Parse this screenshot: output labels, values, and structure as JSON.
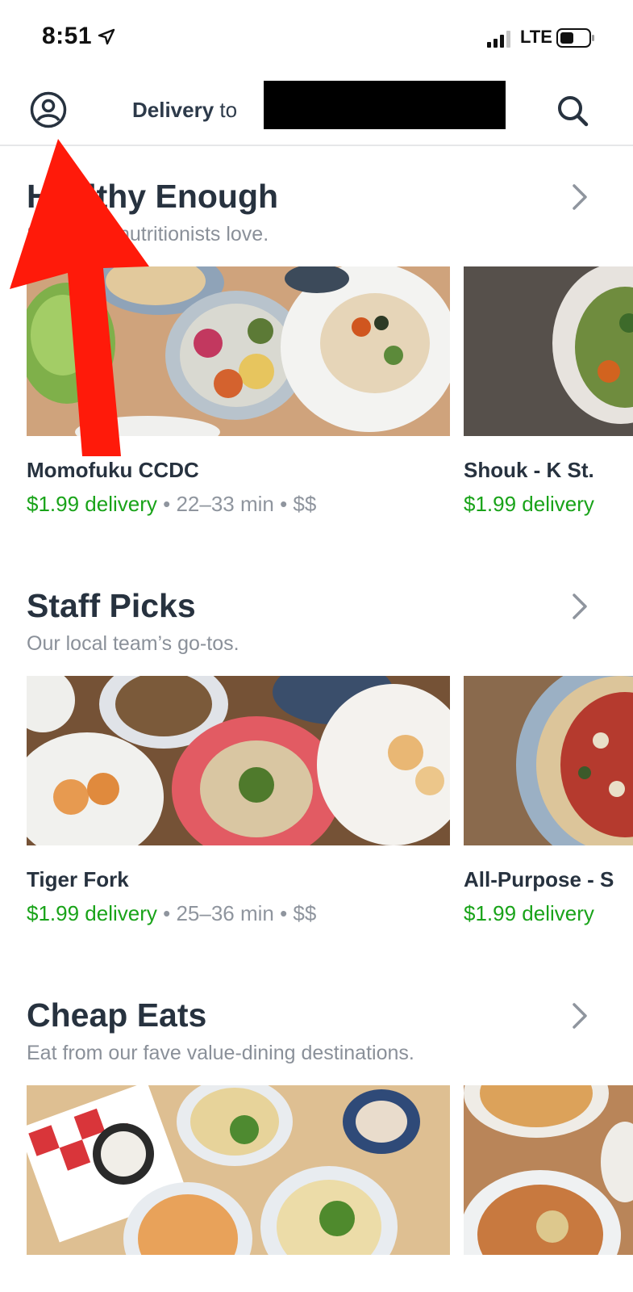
{
  "status_bar": {
    "time": "8:51",
    "network": "LTE"
  },
  "header": {
    "delivery_label": "Delivery",
    "to_label": "to",
    "address": ""
  },
  "icons": {
    "profile": "profile-icon",
    "search": "search-icon",
    "chevron": "chevron-right-icon",
    "location": "location-arrow-icon"
  },
  "colors": {
    "delivery_fee_green": "#19a319",
    "annotation_red": "#ff1a0a",
    "title_dark": "#27323f",
    "meta_gray": "#8f959e"
  },
  "sections": [
    {
      "title": "Healthy Enough",
      "subtitle": "Spots our nutritionists love.",
      "cards": [
        {
          "name": "Momofuku CCDC",
          "fee": "$1.99 delivery",
          "meta": " • 22–33 min • $$"
        },
        {
          "name": "Shouk -  K St.",
          "fee": "$1.99 delivery",
          "meta": ""
        }
      ]
    },
    {
      "title": "Staff Picks",
      "subtitle": "Our local team’s go-tos.",
      "cards": [
        {
          "name": "Tiger Fork",
          "fee": "$1.99 delivery",
          "meta": " • 25–36 min • $$"
        },
        {
          "name": "All-Purpose - S",
          "fee": "$1.99 delivery",
          "meta": ""
        }
      ]
    },
    {
      "title": "Cheap Eats",
      "subtitle": "Eat from our fave value-dining destinations.",
      "cards": [
        {
          "name": "",
          "fee": "",
          "meta": ""
        },
        {
          "name": "",
          "fee": "",
          "meta": ""
        }
      ]
    }
  ]
}
